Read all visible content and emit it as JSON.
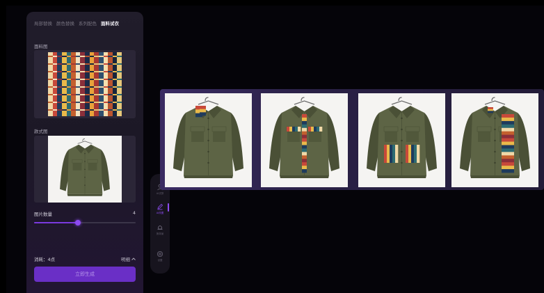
{
  "tabs": [
    {
      "label": "局部替换",
      "active": false
    },
    {
      "label": "颜色替换",
      "active": false
    },
    {
      "label": "系列配色",
      "active": false
    },
    {
      "label": "面料试衣",
      "active": true
    }
  ],
  "fabric_section": {
    "label": "面料图"
  },
  "style_section": {
    "label": "款式图"
  },
  "image_count": {
    "label": "图片数量",
    "value": "4",
    "fraction": 0.43
  },
  "cost": {
    "label": "消耗：4点",
    "detail_label": "明细"
  },
  "generate_button": {
    "label": "立即生成"
  },
  "rail": {
    "items": [
      {
        "label": "AI试穿",
        "icon": "person-icon",
        "active": false
      },
      {
        "label": "AI改图",
        "icon": "pen-icon",
        "active": true
      },
      {
        "label": "换背景",
        "icon": "bell-icon",
        "active": false
      },
      {
        "label": "设置",
        "icon": "settings-icon",
        "active": false
      }
    ]
  },
  "colors": {
    "accent": "#7b3ae0",
    "jacket": "#5d6445",
    "jacket_dark": "#4a5036",
    "panel_bg": "#1e1a28"
  },
  "results": [
    {
      "variant": "collar-placket"
    },
    {
      "variant": "placket-flaps"
    },
    {
      "variant": "pockets"
    },
    {
      "variant": "side-panel"
    }
  ],
  "fabric_stripes": [
    "#f0d9a8",
    "#c8493a",
    "#1f3b5c",
    "#e9b94a",
    "#2d6b72",
    "#c4602e",
    "#f2e4c4",
    "#8b2f3a",
    "#1c2a48",
    "#e8a23b",
    "#a83832",
    "#2f4f6e",
    "#f4dfb0",
    "#b9542f",
    "#16253d",
    "#e6c77a"
  ]
}
